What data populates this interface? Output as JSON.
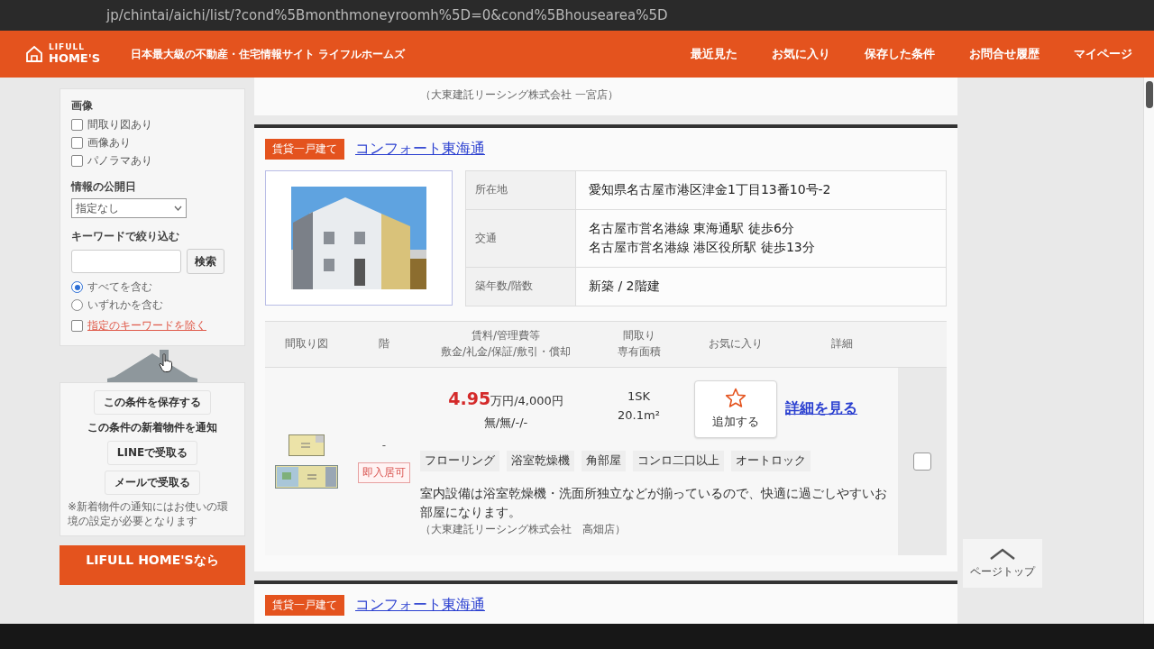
{
  "browser": {
    "url": "jp/chintai/aichi/list/?cond%5Bmonthmoneyroomh%5D=0&cond%5Bhousearea%5D"
  },
  "header": {
    "logo_top": "LIFULL",
    "logo": "HOME'S",
    "tagline": "日本最大級の不動産・住宅情報サイト ライフルホームズ",
    "nav": [
      "最近見た",
      "お気に入り",
      "保存した条件",
      "お問合せ履歴",
      "マイページ"
    ]
  },
  "sidebar": {
    "image_filter": {
      "title": "画像",
      "options": [
        {
          "label": "間取り図あり",
          "checked": false
        },
        {
          "label": "画像あり",
          "checked": false
        },
        {
          "label": "パノラマあり",
          "checked": false
        }
      ]
    },
    "publish_date": {
      "title": "情報の公開日",
      "value": "指定なし"
    },
    "keyword": {
      "title": "キーワードで絞り込む",
      "button": "検索",
      "modes": [
        {
          "label": "すべてを含む",
          "selected": true
        },
        {
          "label": "いずれかを含む",
          "selected": false
        }
      ],
      "exclude": {
        "label": "指定のキーワードを除く",
        "checked": false
      }
    },
    "save_button": "この条件を保存する",
    "notify": {
      "title": "この条件の新着物件を通知",
      "buttons": [
        "LINEで受取る",
        "メールで受取る"
      ],
      "note": "※新着物件の通知にはお使いの環境の設定が必要となります"
    },
    "promo_button": "LIFULL HOME'Sなら"
  },
  "previous_listing": {
    "company": "（大東建託リーシング株式会社 一宮店）"
  },
  "listing": {
    "badge": "賃貸一戸建て",
    "name": "コンフォート東海通",
    "details": [
      {
        "label": "所在地",
        "lines": [
          "愛知県名古屋市港区津金1丁目13番10号-2"
        ]
      },
      {
        "label": "交通",
        "lines": [
          "名古屋市営名港線 東海通駅 徒歩6分",
          "名古屋市営名港線 港区役所駅 徒歩13分"
        ]
      },
      {
        "label": "築年数/階数",
        "lines": [
          "新築 / 2階建"
        ]
      }
    ],
    "columns": [
      [
        "間取り図"
      ],
      [
        "階"
      ],
      [
        "賃料/管理費等",
        "敷金/礼金/保証/敷引・償却"
      ],
      [
        "間取り",
        "専有面積"
      ],
      [
        "お気に入り"
      ],
      [
        "詳細"
      ]
    ],
    "rooms": [
      {
        "floor": "-",
        "status": "即入居可",
        "rent_amount": "4.95",
        "rent_rest": "万円/4,000円",
        "deposits": "無/無/-/-",
        "layout": "1SK",
        "area": "20.1m²",
        "favorite_button": "追加する",
        "favorited": false,
        "detail_link": "詳細を見る",
        "tags": [
          "フローリング",
          "浴室乾燥機",
          "角部屋",
          "コンロ二口以上",
          "オートロック"
        ],
        "description": "室内設備は浴室乾燥機・洗面所独立などが揃っているので、快適に過ごしやすいお部屋になります。",
        "company": "（大東建託リーシング株式会社　高畑店）",
        "checked": false
      }
    ]
  },
  "next_listing": {
    "badge": "賃貸一戸建て",
    "name": "コンフォート東海通"
  },
  "page_top": "ページトップ"
}
